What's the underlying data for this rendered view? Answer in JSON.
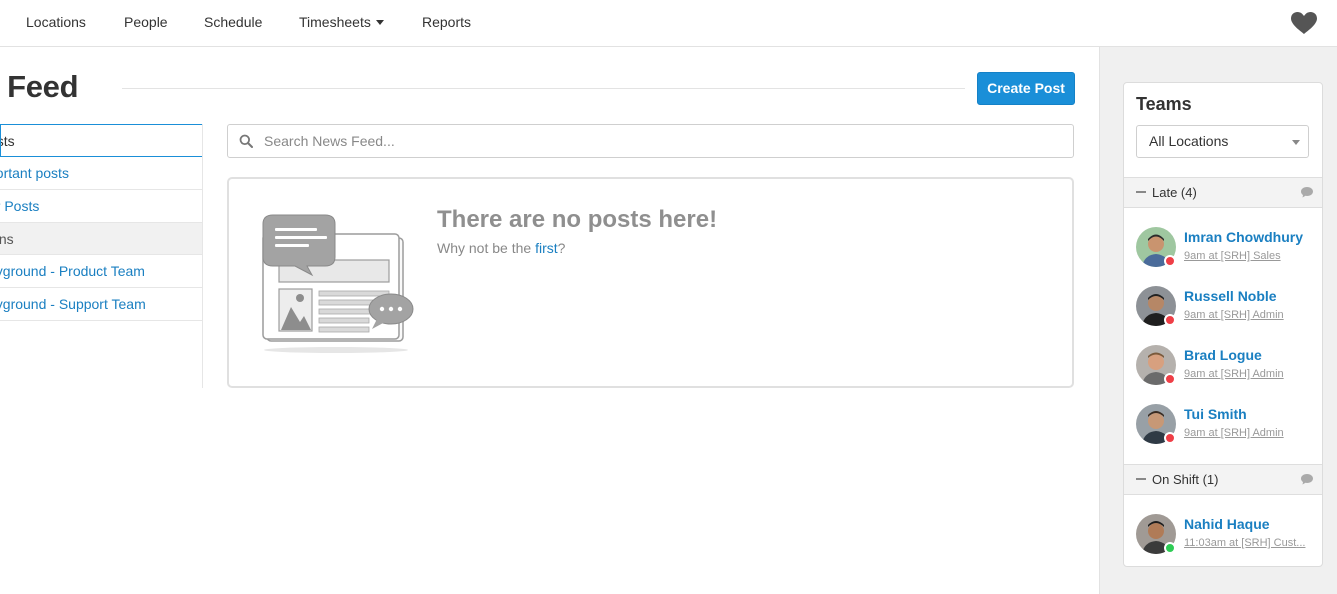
{
  "nav": {
    "items": [
      "Locations",
      "People",
      "Schedule",
      "Timesheets",
      "Reports"
    ],
    "timesheets_has_dropdown": true,
    "right_icon": "heart-icon"
  },
  "page": {
    "title": "ws Feed",
    "create_button": "Create Post"
  },
  "filters": {
    "items": [
      {
        "label": "osts",
        "state": "active"
      },
      {
        "label": "portant posts",
        "state": "link"
      },
      {
        "label": "ur Posts",
        "state": "link"
      },
      {
        "label": "ions",
        "state": "header"
      },
      {
        "label": "ayground - Product Team",
        "state": "link"
      },
      {
        "label": "ayground - Support Team",
        "state": "link"
      }
    ]
  },
  "search": {
    "placeholder": "Search News Feed...",
    "value": "",
    "icon": "search-icon"
  },
  "feed": {
    "empty_title": "There are no posts here!",
    "empty_sub_prefix": "Why not be the ",
    "empty_sub_link": "first",
    "empty_sub_suffix": "?"
  },
  "teams": {
    "title": "Teams",
    "location_select": "All Locations",
    "groups": [
      {
        "label": "Late (4)",
        "status_color": "#ef3e46",
        "people": [
          {
            "name": "Imran Chowdhury",
            "shift": "9am at [SRH] Sales"
          },
          {
            "name": "Russell Noble",
            "shift": "9am at [SRH] Admin"
          },
          {
            "name": "Brad Logue",
            "shift": "9am at [SRH] Admin"
          },
          {
            "name": "Tui Smith",
            "shift": "9am at [SRH] Admin"
          }
        ]
      },
      {
        "label": "On Shift (1)",
        "status_color": "#2ecc55",
        "people": [
          {
            "name": "Nahid Haque",
            "shift": "11:03am at [SRH] Cust..."
          }
        ]
      }
    ]
  },
  "colors": {
    "accent": "#1a8fd8",
    "link": "#1a7fc1",
    "late": "#ef3e46",
    "on_shift": "#2ecc55"
  }
}
